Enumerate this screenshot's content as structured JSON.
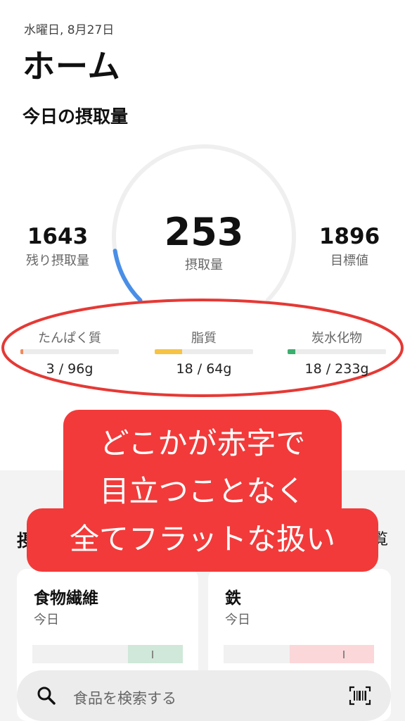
{
  "header": {
    "date": "水曜日, 8月27日",
    "title": "ホーム",
    "section_title": "今日の摂取量"
  },
  "calories": {
    "remaining": {
      "value": "1643",
      "label": "残り摂取量"
    },
    "consumed": {
      "value": "253",
      "label": "摂取量"
    },
    "target": {
      "value": "1896",
      "label": "目標値"
    },
    "ring_progress": 0.133
  },
  "macros": [
    {
      "name": "たんぱく質",
      "value": "3 / 96g",
      "progress": 0.03,
      "color": "#f08a5d"
    },
    {
      "name": "脂質",
      "value": "18 / 64g",
      "progress": 0.28,
      "color": "#f6c344"
    },
    {
      "name": "炭水化物",
      "value": "18 / 233g",
      "progress": 0.08,
      "color": "#3cae6e"
    }
  ],
  "nutrients_section": {
    "title_peek": "摂",
    "action_peek": "覧"
  },
  "cards": [
    {
      "title": "食物繊維",
      "subtitle": "今日",
      "zone_color": "#cfe8d9"
    },
    {
      "title": "鉄",
      "subtitle": "今日",
      "zone_color": "#fbd7da"
    }
  ],
  "annotation": {
    "lines": [
      "どこかが赤字で",
      "目立つことなく",
      "全てフラットな扱い"
    ],
    "color": "#f23a3a",
    "highlight_color": "#e53935"
  },
  "search": {
    "placeholder": "食品を検索する",
    "icon": "search-icon",
    "scan_icon": "barcode-scan-icon"
  },
  "colors": {
    "accent_blue": "#4a8fe7",
    "ring_track": "#efefef"
  }
}
